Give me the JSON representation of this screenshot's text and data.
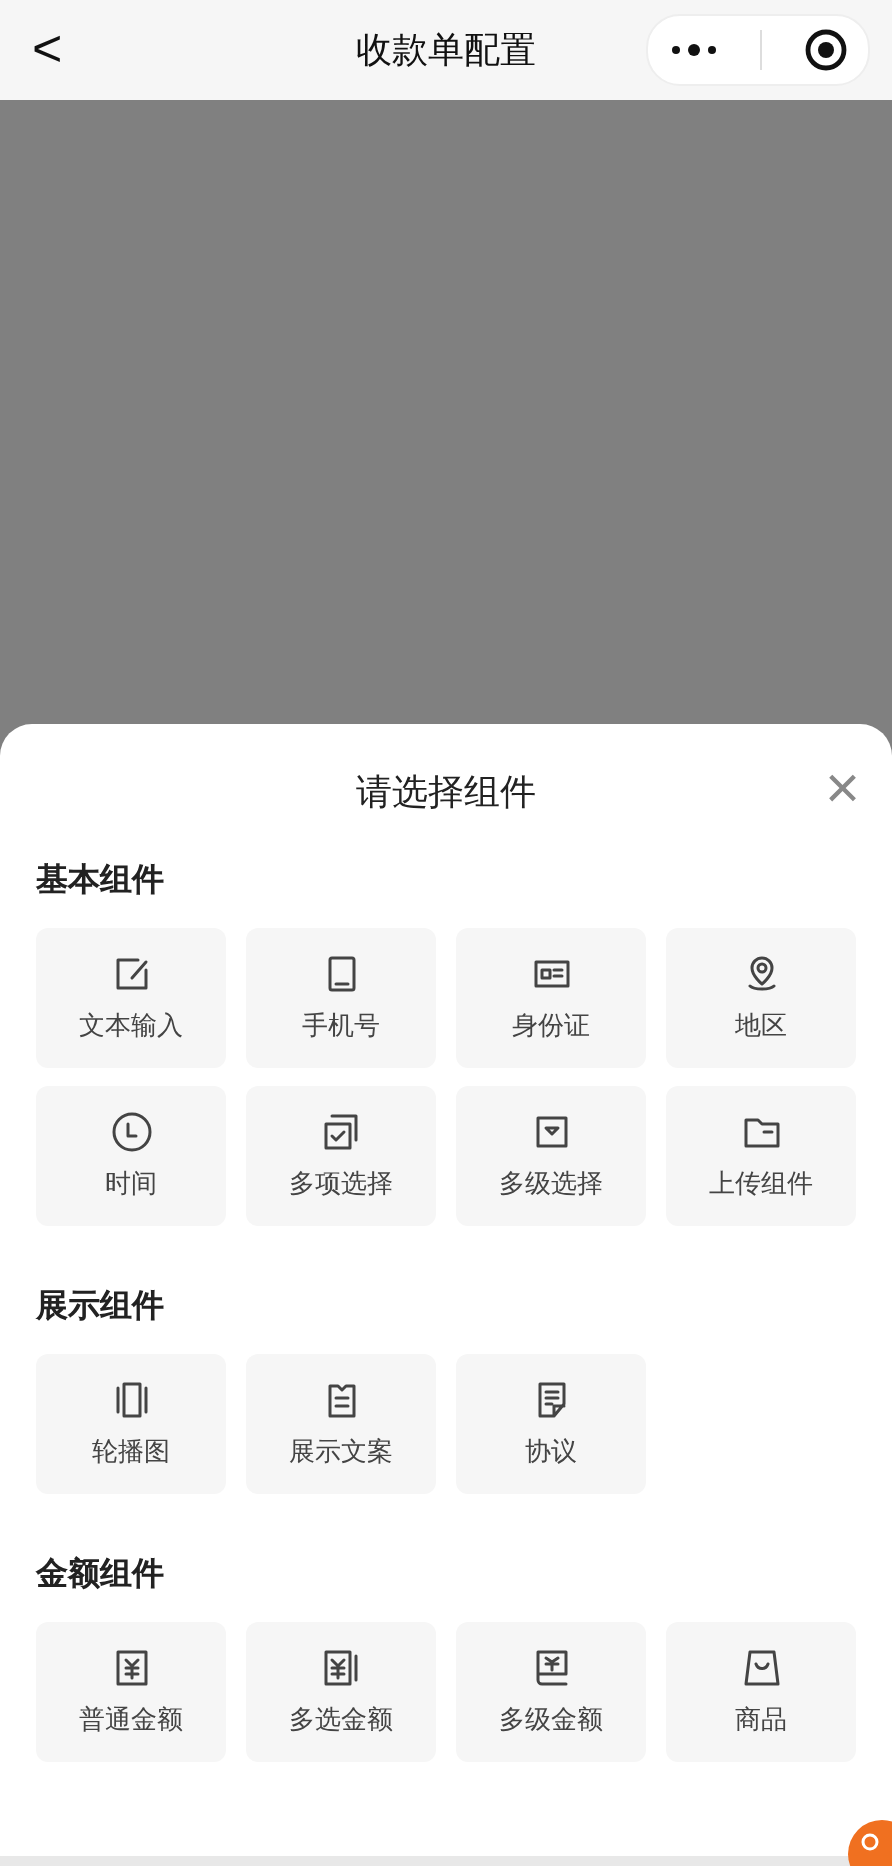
{
  "nav_bar": {
    "back": "<",
    "title": "收款单配置"
  },
  "sheet": {
    "title": "请选择组件",
    "close": "×",
    "sections": [
      {
        "heading": "基本组件",
        "items": [
          {
            "label": "文本输入"
          },
          {
            "label": "手机号"
          },
          {
            "label": "身份证"
          },
          {
            "label": "地区"
          },
          {
            "label": "时间"
          },
          {
            "label": "多项选择"
          },
          {
            "label": "多级选择"
          },
          {
            "label": "上传组件"
          }
        ]
      },
      {
        "heading": "展示组件",
        "items": [
          {
            "label": "轮播图"
          },
          {
            "label": "展示文案"
          },
          {
            "label": "协议"
          }
        ]
      },
      {
        "heading": "金额组件",
        "items": [
          {
            "label": "普通金额"
          },
          {
            "label": "多选金额"
          },
          {
            "label": "多级金额"
          },
          {
            "label": "商品"
          }
        ]
      }
    ]
  }
}
